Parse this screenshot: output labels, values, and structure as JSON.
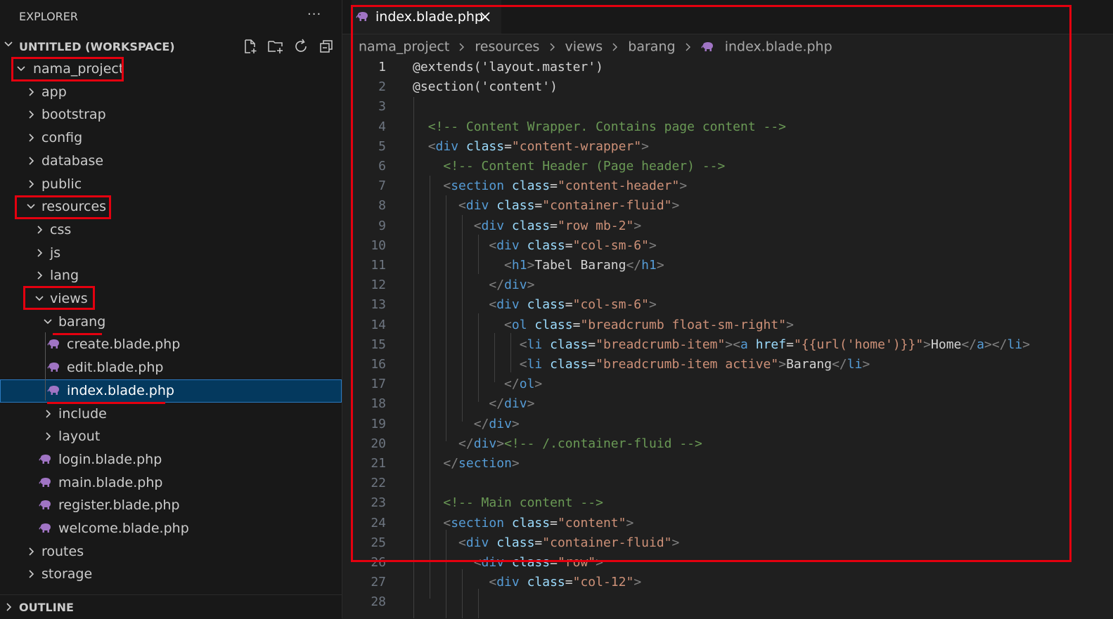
{
  "explorer": {
    "title": "EXPLORER",
    "more": "···",
    "workspace_title": "UNTITLED (WORKSPACE)",
    "actions": [
      "new-file-icon",
      "new-folder-icon",
      "refresh-icon",
      "collapse-all-icon"
    ],
    "tree": [
      {
        "label": "nama_project",
        "type": "folder",
        "expanded": true,
        "depth": 0
      },
      {
        "label": "app",
        "type": "folder",
        "expanded": false,
        "depth": 1
      },
      {
        "label": "bootstrap",
        "type": "folder",
        "expanded": false,
        "depth": 1
      },
      {
        "label": "config",
        "type": "folder",
        "expanded": false,
        "depth": 1
      },
      {
        "label": "database",
        "type": "folder",
        "expanded": false,
        "depth": 1
      },
      {
        "label": "public",
        "type": "folder",
        "expanded": false,
        "depth": 1
      },
      {
        "label": "resources",
        "type": "folder",
        "expanded": true,
        "depth": 1
      },
      {
        "label": "css",
        "type": "folder",
        "expanded": false,
        "depth": 2
      },
      {
        "label": "js",
        "type": "folder",
        "expanded": false,
        "depth": 2
      },
      {
        "label": "lang",
        "type": "folder",
        "expanded": false,
        "depth": 2
      },
      {
        "label": "views",
        "type": "folder",
        "expanded": true,
        "depth": 2
      },
      {
        "label": "barang",
        "type": "folder",
        "expanded": true,
        "depth": 3
      },
      {
        "label": "create.blade.php",
        "type": "file",
        "depth": 4
      },
      {
        "label": "edit.blade.php",
        "type": "file",
        "depth": 4
      },
      {
        "label": "index.blade.php",
        "type": "file",
        "depth": 4,
        "selected": true
      },
      {
        "label": "include",
        "type": "folder",
        "expanded": false,
        "depth": 3
      },
      {
        "label": "layout",
        "type": "folder",
        "expanded": false,
        "depth": 3
      },
      {
        "label": "login.blade.php",
        "type": "file",
        "depth": 3
      },
      {
        "label": "main.blade.php",
        "type": "file",
        "depth": 3
      },
      {
        "label": "register.blade.php",
        "type": "file",
        "depth": 3
      },
      {
        "label": "welcome.blade.php",
        "type": "file",
        "depth": 3
      },
      {
        "label": "routes",
        "type": "folder",
        "expanded": false,
        "depth": 1
      },
      {
        "label": "storage",
        "type": "folder",
        "expanded": false,
        "depth": 1
      }
    ],
    "outline_label": "OUTLINE"
  },
  "editor": {
    "tab": {
      "label": "index.blade.php",
      "icon": "php-elephant-icon",
      "close": "close-icon"
    },
    "breadcrumb": [
      "nama_project",
      "resources",
      "views",
      "barang",
      "index.blade.php"
    ],
    "active_line": 1,
    "lines": [
      [
        [
          "t",
          "@extends('layout.master')"
        ]
      ],
      [
        [
          "t",
          "@section('content')"
        ]
      ],
      [],
      [
        [
          "s",
          "  "
        ],
        [
          "c",
          "<!-- Content Wrapper. Contains page content -->"
        ]
      ],
      [
        [
          "s",
          "  "
        ],
        [
          "p",
          "<"
        ],
        [
          "g",
          "div"
        ],
        [
          "s",
          " "
        ],
        [
          "a",
          "class"
        ],
        [
          "t",
          "="
        ],
        [
          "v",
          "\"content-wrapper\""
        ],
        [
          "p",
          ">"
        ]
      ],
      [
        [
          "s",
          "    "
        ],
        [
          "c",
          "<!-- Content Header (Page header) -->"
        ]
      ],
      [
        [
          "s",
          "    "
        ],
        [
          "p",
          "<"
        ],
        [
          "g",
          "section"
        ],
        [
          "s",
          " "
        ],
        [
          "a",
          "class"
        ],
        [
          "t",
          "="
        ],
        [
          "v",
          "\"content-header\""
        ],
        [
          "p",
          ">"
        ]
      ],
      [
        [
          "s",
          "      "
        ],
        [
          "p",
          "<"
        ],
        [
          "g",
          "div"
        ],
        [
          "s",
          " "
        ],
        [
          "a",
          "class"
        ],
        [
          "t",
          "="
        ],
        [
          "v",
          "\"container-fluid\""
        ],
        [
          "p",
          ">"
        ]
      ],
      [
        [
          "s",
          "        "
        ],
        [
          "p",
          "<"
        ],
        [
          "g",
          "div"
        ],
        [
          "s",
          " "
        ],
        [
          "a",
          "class"
        ],
        [
          "t",
          "="
        ],
        [
          "v",
          "\"row mb-2\""
        ],
        [
          "p",
          ">"
        ]
      ],
      [
        [
          "s",
          "          "
        ],
        [
          "p",
          "<"
        ],
        [
          "g",
          "div"
        ],
        [
          "s",
          " "
        ],
        [
          "a",
          "class"
        ],
        [
          "t",
          "="
        ],
        [
          "v",
          "\"col-sm-6\""
        ],
        [
          "p",
          ">"
        ]
      ],
      [
        [
          "s",
          "            "
        ],
        [
          "p",
          "<"
        ],
        [
          "g",
          "h1"
        ],
        [
          "p",
          ">"
        ],
        [
          "t",
          "Tabel Barang"
        ],
        [
          "p",
          "</"
        ],
        [
          "g",
          "h1"
        ],
        [
          "p",
          ">"
        ]
      ],
      [
        [
          "s",
          "          "
        ],
        [
          "p",
          "</"
        ],
        [
          "g",
          "div"
        ],
        [
          "p",
          ">"
        ]
      ],
      [
        [
          "s",
          "          "
        ],
        [
          "p",
          "<"
        ],
        [
          "g",
          "div"
        ],
        [
          "s",
          " "
        ],
        [
          "a",
          "class"
        ],
        [
          "t",
          "="
        ],
        [
          "v",
          "\"col-sm-6\""
        ],
        [
          "p",
          ">"
        ]
      ],
      [
        [
          "s",
          "            "
        ],
        [
          "p",
          "<"
        ],
        [
          "g",
          "ol"
        ],
        [
          "s",
          " "
        ],
        [
          "a",
          "class"
        ],
        [
          "t",
          "="
        ],
        [
          "v",
          "\"breadcrumb float-sm-right\""
        ],
        [
          "p",
          ">"
        ]
      ],
      [
        [
          "s",
          "              "
        ],
        [
          "p",
          "<"
        ],
        [
          "g",
          "li"
        ],
        [
          "s",
          " "
        ],
        [
          "a",
          "class"
        ],
        [
          "t",
          "="
        ],
        [
          "v",
          "\"breadcrumb-item\""
        ],
        [
          "p",
          ">"
        ],
        [
          "p",
          "<"
        ],
        [
          "g",
          "a"
        ],
        [
          "s",
          " "
        ],
        [
          "a",
          "href"
        ],
        [
          "t",
          "="
        ],
        [
          "v",
          "\"{{url('home')}}\""
        ],
        [
          "p",
          ">"
        ],
        [
          "t",
          "Home"
        ],
        [
          "p",
          "</"
        ],
        [
          "g",
          "a"
        ],
        [
          "p",
          ">"
        ],
        [
          "p",
          "</"
        ],
        [
          "g",
          "li"
        ],
        [
          "p",
          ">"
        ]
      ],
      [
        [
          "s",
          "              "
        ],
        [
          "p",
          "<"
        ],
        [
          "g",
          "li"
        ],
        [
          "s",
          " "
        ],
        [
          "a",
          "class"
        ],
        [
          "t",
          "="
        ],
        [
          "v",
          "\"breadcrumb-item active\""
        ],
        [
          "p",
          ">"
        ],
        [
          "t",
          "Barang"
        ],
        [
          "p",
          "</"
        ],
        [
          "g",
          "li"
        ],
        [
          "p",
          ">"
        ]
      ],
      [
        [
          "s",
          "            "
        ],
        [
          "p",
          "</"
        ],
        [
          "g",
          "ol"
        ],
        [
          "p",
          ">"
        ]
      ],
      [
        [
          "s",
          "          "
        ],
        [
          "p",
          "</"
        ],
        [
          "g",
          "div"
        ],
        [
          "p",
          ">"
        ]
      ],
      [
        [
          "s",
          "        "
        ],
        [
          "p",
          "</"
        ],
        [
          "g",
          "div"
        ],
        [
          "p",
          ">"
        ]
      ],
      [
        [
          "s",
          "      "
        ],
        [
          "p",
          "</"
        ],
        [
          "g",
          "div"
        ],
        [
          "p",
          ">"
        ],
        [
          "c",
          "<!-- /.container-fluid -->"
        ]
      ],
      [
        [
          "s",
          "    "
        ],
        [
          "p",
          "</"
        ],
        [
          "g",
          "section"
        ],
        [
          "p",
          ">"
        ]
      ],
      [],
      [
        [
          "s",
          "    "
        ],
        [
          "c",
          "<!-- Main content -->"
        ]
      ],
      [
        [
          "s",
          "    "
        ],
        [
          "p",
          "<"
        ],
        [
          "g",
          "section"
        ],
        [
          "s",
          " "
        ],
        [
          "a",
          "class"
        ],
        [
          "t",
          "="
        ],
        [
          "v",
          "\"content\""
        ],
        [
          "p",
          ">"
        ]
      ],
      [
        [
          "s",
          "      "
        ],
        [
          "p",
          "<"
        ],
        [
          "g",
          "div"
        ],
        [
          "s",
          " "
        ],
        [
          "a",
          "class"
        ],
        [
          "t",
          "="
        ],
        [
          "v",
          "\"container-fluid\""
        ],
        [
          "p",
          ">"
        ]
      ],
      [
        [
          "s",
          "        "
        ],
        [
          "p",
          "<"
        ],
        [
          "g",
          "div"
        ],
        [
          "s",
          " "
        ],
        [
          "a",
          "class"
        ],
        [
          "t",
          "="
        ],
        [
          "v",
          "\"row\""
        ],
        [
          "p",
          ">"
        ]
      ],
      [
        [
          "s",
          "          "
        ],
        [
          "p",
          "<"
        ],
        [
          "g",
          "div"
        ],
        [
          "s",
          " "
        ],
        [
          "a",
          "class"
        ],
        [
          "t",
          "="
        ],
        [
          "v",
          "\"col-12\""
        ],
        [
          "p",
          ">"
        ]
      ],
      []
    ]
  },
  "colors": {
    "annotation_red": "#e4000f",
    "selection_bg": "#04395e",
    "tag": "#569cd6",
    "attribute": "#9cdcfe",
    "string": "#ce9178",
    "comment": "#6a9955",
    "php_icon": "#a074c4"
  }
}
